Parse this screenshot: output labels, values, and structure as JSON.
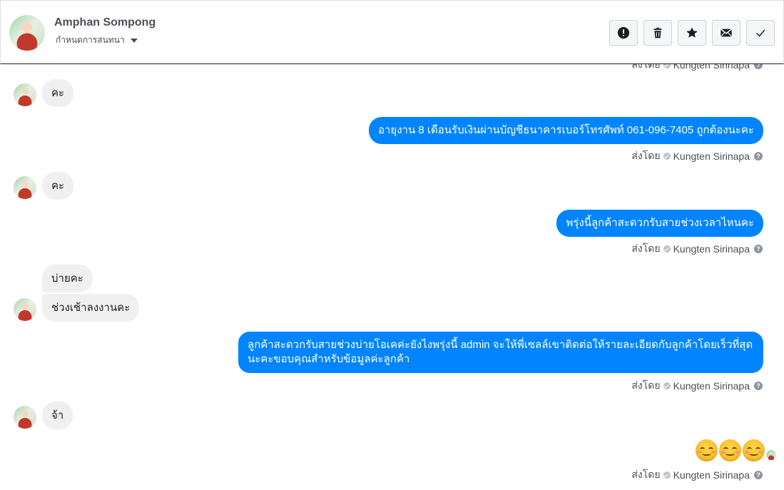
{
  "header": {
    "contact_name": "Amphan Sompong",
    "conversation_label": "กำหนดการสนทนา",
    "buttons": [
      {
        "name": "report-button",
        "icon": "exclamation-icon"
      },
      {
        "name": "delete-button",
        "icon": "trash-icon"
      },
      {
        "name": "star-button",
        "icon": "star-icon"
      },
      {
        "name": "mark-unread-button",
        "icon": "envelope-icon"
      },
      {
        "name": "mark-done-button",
        "icon": "checkmark-icon"
      }
    ]
  },
  "colors": {
    "outgoing_bubble": "#0084ff",
    "incoming_bubble": "#f1f0f0",
    "meta_text": "#4b4f56"
  },
  "sent_by_prefix": "ส่งโดย",
  "sent_by_name": "Kungten Sirinapa",
  "messages": [
    {
      "direction": "meta-partial",
      "text": "ส่งโดย Kungten Sirinapa"
    },
    {
      "direction": "in",
      "text": "คะ"
    },
    {
      "direction": "out",
      "text": "อายุงาน 8 เดือนรับเงินผ่านบัญชีธนาคารเบอร์โทรศัพท์ 061-096-7405 ถูกต้องนะคะ"
    },
    {
      "direction": "in",
      "text": "คะ"
    },
    {
      "direction": "out",
      "text": "พรุ่งนี้ลูกค้าสะดวกรับสายช่วงเวลาไหนคะ"
    },
    {
      "direction": "in",
      "text": "บ่ายคะ"
    },
    {
      "direction": "in",
      "text": "ช่วงเช้าลงงานคะ"
    },
    {
      "direction": "out",
      "text": "ลูกค้าสะดวกรับสายช่วงบ่ายโอเคค่ะยังไงพรุ่งนี้ admin จะให้พี่เซลล์เขาติดต่อให้รายละเอียดกับลูกค้าโดยเร็วที่สุดนะคะขอบคุณสำหรับข้อมูลค่ะลูกค้า"
    },
    {
      "direction": "in",
      "text": "จ้า"
    },
    {
      "direction": "out",
      "text": "☺☺☺",
      "emoji_count": 3,
      "emoji": "smiling-face-icon"
    }
  ]
}
